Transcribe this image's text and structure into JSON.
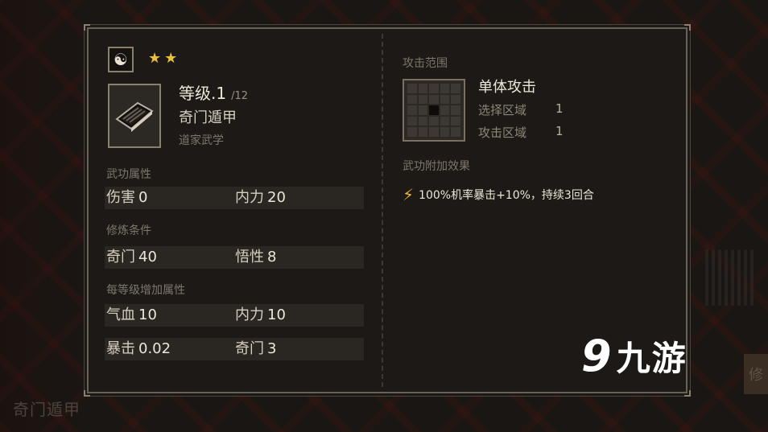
{
  "background": {
    "bottom_label": "奇门遁甲",
    "right_button_label": "修"
  },
  "panel": {
    "stars": 2,
    "level_label": "等级.1",
    "level_max": "/12",
    "skill_name": "奇门遁甲",
    "skill_type": "道家武学",
    "attributes": {
      "section_label": "武功属性",
      "items": [
        {
          "name": "伤害",
          "value": "0"
        },
        {
          "name": "内力",
          "value": "20"
        }
      ]
    },
    "requirements": {
      "section_label": "修炼条件",
      "items": [
        {
          "name": "奇门",
          "value": "40"
        },
        {
          "name": "悟性",
          "value": "8"
        }
      ]
    },
    "per_level": {
      "section_label": "每等级增加属性",
      "rows": [
        [
          {
            "name": "气血",
            "value": "10"
          },
          {
            "name": "内力",
            "value": "10"
          }
        ],
        [
          {
            "name": "暴击",
            "value": "0.02"
          },
          {
            "name": "奇门",
            "value": "3"
          }
        ]
      ]
    },
    "attack_range": {
      "section_label": "攻击范围",
      "attack_type": "单体攻击",
      "select_area_label": "选择区域",
      "select_area_value": "1",
      "attack_area_label": "攻击区域",
      "attack_area_value": "1"
    },
    "extra_effect": {
      "section_label": "武功附加效果",
      "text": "100%机率暴击+10%，持续3回合"
    }
  },
  "watermark": {
    "logo": "9",
    "text": "九游"
  },
  "colors": {
    "star": "#e8c23a",
    "bolt": "#e8b83a",
    "panel_border": "#6a6155",
    "stat_row_bg": "#2a2622"
  }
}
